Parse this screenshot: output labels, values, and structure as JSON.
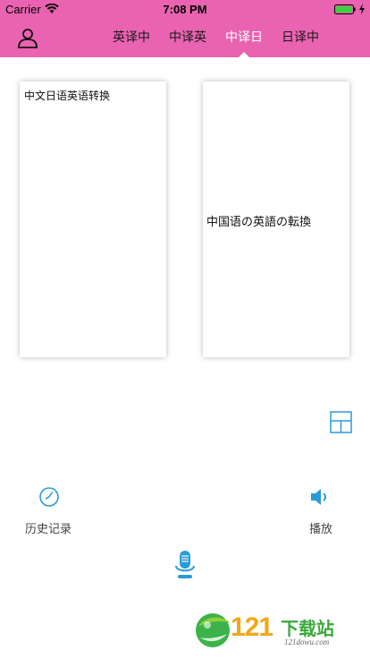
{
  "status_bar": {
    "carrier": "Carrier",
    "time": "7:08 PM"
  },
  "header": {
    "background": "#e963b0",
    "tabs": [
      {
        "label": "英译中",
        "active": false
      },
      {
        "label": "中译英",
        "active": false
      },
      {
        "label": "中译日",
        "active": true
      },
      {
        "label": "日译中",
        "active": false
      }
    ]
  },
  "panels": {
    "source_text": "中文日语英语转换",
    "result_text": "中国语の英語の転換"
  },
  "actions": {
    "history_label": "历史记录",
    "play_label": "播放"
  },
  "accent_color": "#2a9bd8",
  "watermark": {
    "number": "121",
    "text": "下载站",
    "site": "121dowu.com"
  }
}
